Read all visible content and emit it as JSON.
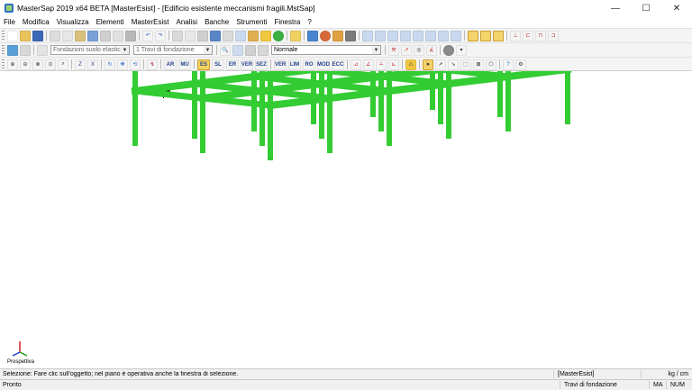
{
  "window": {
    "title": "MasterSap 2019 x64 BETA [MasterEsist] - [Edificio esistente meccanismi fragili.MstSap]",
    "controls": [
      "—",
      "☐",
      "✕"
    ]
  },
  "menu": [
    "File",
    "Modifica",
    "Visualizza",
    "Elementi",
    "MasterEsist",
    "Analisi",
    "Banche",
    "Strumenti",
    "Finestra",
    "?"
  ],
  "toolbar2": {
    "combo_foundation": "Fondazioni suolo elastic",
    "combo_elements": "1 Travi di fondazione",
    "combo_view": "Normale"
  },
  "toolbar3": {
    "btn_labels": [
      "AR",
      "MU",
      "ES",
      "SL",
      "ER",
      "VER",
      "SEZ",
      "VER",
      "LIM",
      "RO",
      "MOD",
      "ECC"
    ]
  },
  "viewport": {
    "axis_label": "Prospettiva",
    "model_color": "#33cc33"
  },
  "status": {
    "row1_text": "Selezione: Fare clic sull'oggetto; nel piano è operativa anche la finestra di selezione.",
    "row1_module": "[MasterEsist]",
    "row1_units": "kg / cm",
    "row2_text": "Pronto",
    "row2_layer": "Travi di fondazione",
    "row2_caps": "MA",
    "row2_num": "NUM"
  }
}
